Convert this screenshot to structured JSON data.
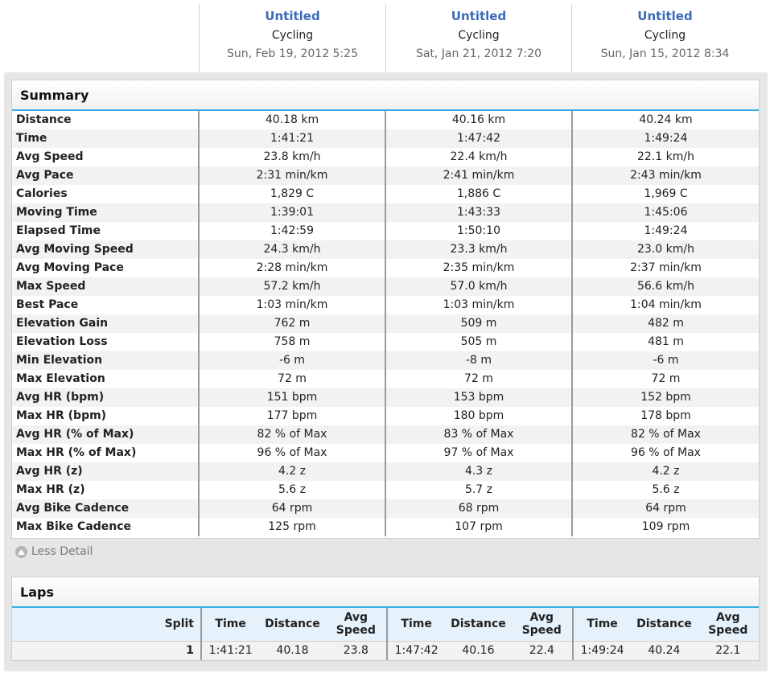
{
  "activities": [
    {
      "title": "Untitled",
      "sport": "Cycling",
      "date": "Sun, Feb 19, 2012 5:25"
    },
    {
      "title": "Untitled",
      "sport": "Cycling",
      "date": "Sat, Jan 21, 2012 7:20"
    },
    {
      "title": "Untitled",
      "sport": "Cycling",
      "date": "Sun, Jan 15, 2012 8:34"
    }
  ],
  "summary": {
    "title": "Summary",
    "rows": [
      {
        "label": "Distance",
        "values": [
          "40.18 km",
          "40.16 km",
          "40.24 km"
        ]
      },
      {
        "label": "Time",
        "values": [
          "1:41:21",
          "1:47:42",
          "1:49:24"
        ]
      },
      {
        "label": "Avg Speed",
        "values": [
          "23.8 km/h",
          "22.4 km/h",
          "22.1 km/h"
        ]
      },
      {
        "label": "Avg Pace",
        "values": [
          "2:31 min/km",
          "2:41 min/km",
          "2:43 min/km"
        ]
      },
      {
        "label": "Calories",
        "values": [
          "1,829 C",
          "1,886 C",
          "1,969 C"
        ]
      },
      {
        "label": "Moving Time",
        "values": [
          "1:39:01",
          "1:43:33",
          "1:45:06"
        ]
      },
      {
        "label": "Elapsed Time",
        "values": [
          "1:42:59",
          "1:50:10",
          "1:49:24"
        ]
      },
      {
        "label": "Avg Moving Speed",
        "values": [
          "24.3 km/h",
          "23.3 km/h",
          "23.0 km/h"
        ]
      },
      {
        "label": "Avg Moving Pace",
        "values": [
          "2:28 min/km",
          "2:35 min/km",
          "2:37 min/km"
        ]
      },
      {
        "label": "Max Speed",
        "values": [
          "57.2 km/h",
          "57.0 km/h",
          "56.6 km/h"
        ]
      },
      {
        "label": "Best Pace",
        "values": [
          "1:03 min/km",
          "1:03 min/km",
          "1:04 min/km"
        ]
      },
      {
        "label": "Elevation Gain",
        "values": [
          "762 m",
          "509 m",
          "482 m"
        ]
      },
      {
        "label": "Elevation Loss",
        "values": [
          "758 m",
          "505 m",
          "481 m"
        ]
      },
      {
        "label": "Min Elevation",
        "values": [
          "-6 m",
          "-8 m",
          "-6 m"
        ]
      },
      {
        "label": "Max Elevation",
        "values": [
          "72 m",
          "72 m",
          "72 m"
        ]
      },
      {
        "label": "Avg HR (bpm)",
        "values": [
          "151 bpm",
          "153 bpm",
          "152 bpm"
        ]
      },
      {
        "label": "Max HR (bpm)",
        "values": [
          "177 bpm",
          "180 bpm",
          "178 bpm"
        ]
      },
      {
        "label": "Avg HR (% of Max)",
        "values": [
          "82 % of Max",
          "83 % of Max",
          "82 % of Max"
        ]
      },
      {
        "label": "Max HR (% of Max)",
        "values": [
          "96 % of Max",
          "97 % of Max",
          "96 % of Max"
        ]
      },
      {
        "label": "Avg HR (z)",
        "values": [
          "4.2 z",
          "4.3 z",
          "4.2 z"
        ]
      },
      {
        "label": "Max HR (z)",
        "values": [
          "5.6 z",
          "5.7 z",
          "5.6 z"
        ]
      },
      {
        "label": "Avg Bike Cadence",
        "values": [
          "64 rpm",
          "68 rpm",
          "64 rpm"
        ]
      },
      {
        "label": "Max Bike Cadence",
        "values": [
          "125 rpm",
          "107 rpm",
          "109 rpm"
        ]
      }
    ]
  },
  "less_detail": {
    "label": "Less Detail",
    "icon": "arrow-up-circle-icon"
  },
  "laps": {
    "title": "Laps",
    "split_header": "Split",
    "group_headers": [
      "Time",
      "Distance",
      "Avg Speed"
    ],
    "rows": [
      {
        "split": "1",
        "groups": [
          [
            "1:41:21",
            "40.18",
            "23.8"
          ],
          [
            "1:47:42",
            "40.16",
            "22.4"
          ],
          [
            "1:49:24",
            "40.24",
            "22.1"
          ]
        ]
      }
    ]
  },
  "colors": {
    "accent": "#34aee3",
    "link": "#3b6bb8",
    "panel": "#e6e6e6"
  }
}
